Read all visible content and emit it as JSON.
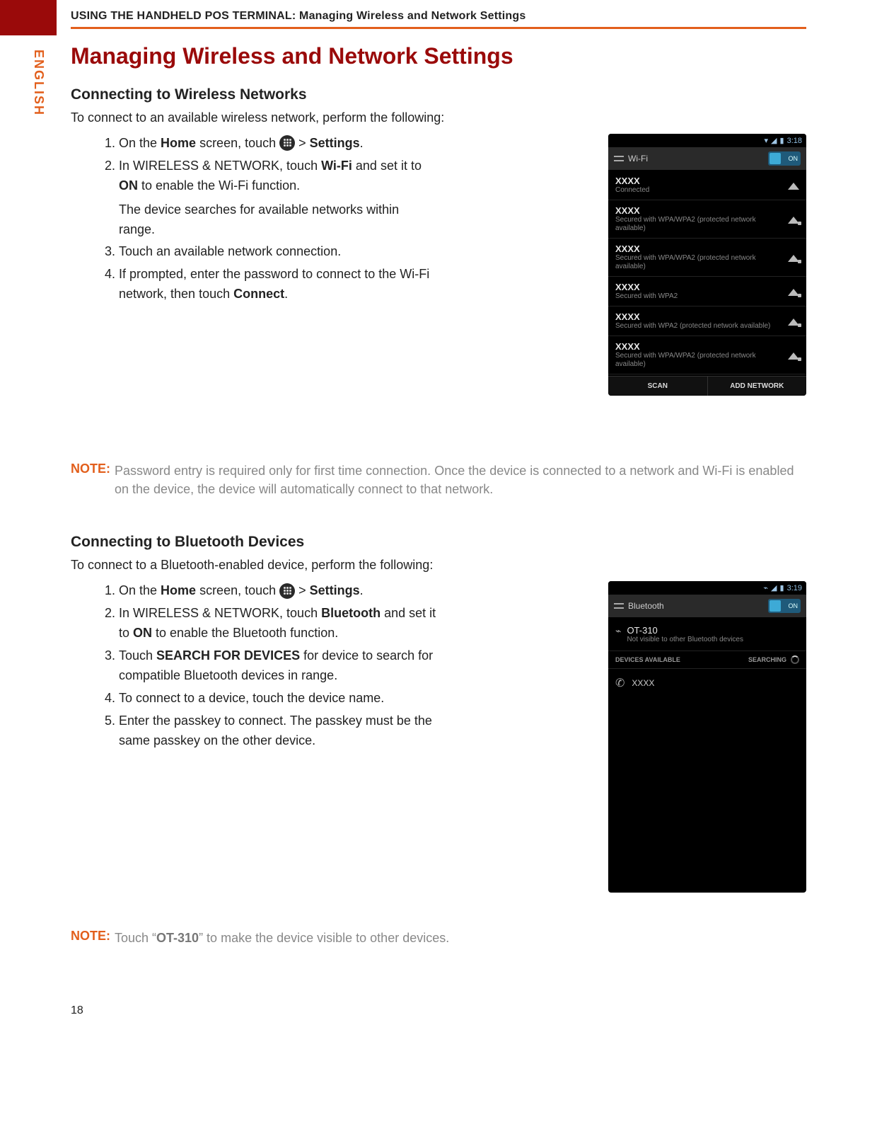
{
  "header": {
    "breadcrumb_prefix": "USING THE HANDHELD POS TERMINAL: ",
    "breadcrumb_section": "Managing Wireless and Network Settings"
  },
  "side_tab": "ENGLISH",
  "title": "Managing Wireless and Network Settings",
  "wifi_section": {
    "heading": "Connecting to Wireless Networks",
    "intro": "To connect to an available wireless network, perform the following:",
    "steps": {
      "s1_pre": "On the ",
      "s1_home": "Home",
      "s1_mid": " screen, touch ",
      "s1_gt": " > ",
      "s1_settings": "Settings",
      "s1_end": ".",
      "s2_a": "In WIRELESS & NETWORK, touch ",
      "s2_wifi": "Wi-Fi",
      "s2_b": " and set it to ",
      "s2_on": "ON",
      "s2_c": " to enable the Wi-Fi function.",
      "s2_extra": "The device searches for available networks within range.",
      "s3": "Touch an available network connection.",
      "s4_a": "If prompted, enter the password to connect to the Wi-Fi network, then touch ",
      "s4_connect": "Connect",
      "s4_b": "."
    },
    "note_label": "NOTE:",
    "note_text": "Password entry is required only for first time connection. Once the device is connected to a network and Wi-Fi is enabled on the device, the device will automatically connect to that network."
  },
  "bt_section": {
    "heading": "Connecting to Bluetooth Devices",
    "intro": "To connect to a Bluetooth-enabled device, perform the following:",
    "steps": {
      "s1_pre": "On the ",
      "s1_home": "Home",
      "s1_mid": " screen, touch ",
      "s1_gt": " > ",
      "s1_settings": "Settings",
      "s1_end": ".",
      "s2_a": "In WIRELESS & NETWORK, touch ",
      "s2_bt": "Bluetooth",
      "s2_b": " and set it to ",
      "s2_on": "ON",
      "s2_c": " to enable the Bluetooth function.",
      "s3_a": "Touch ",
      "s3_search": "SEARCH FOR DEVICES",
      "s3_b": " for device to search for compatible Bluetooth devices in range.",
      "s4": "To connect to a device, touch the device name.",
      "s5": "Enter the passkey to connect. The passkey must be the same passkey on the other device."
    },
    "note_label": "NOTE:",
    "note_a": "Touch “",
    "note_device": "OT-310",
    "note_b": "” to make the device visible to other devices."
  },
  "wifi_phone": {
    "time": "3:18",
    "header": "Wi-Fi",
    "toggle": "ON",
    "networks": [
      {
        "ssid": "XXXX",
        "sub": "Connected",
        "locked": false
      },
      {
        "ssid": "XXXX",
        "sub": "Secured with WPA/WPA2 (protected network available)",
        "locked": true
      },
      {
        "ssid": "XXXX",
        "sub": "Secured with WPA/WPA2 (protected network available)",
        "locked": true
      },
      {
        "ssid": "XXXX",
        "sub": "Secured with WPA2",
        "locked": true
      },
      {
        "ssid": "XXXX",
        "sub": "Secured with WPA2 (protected network available)",
        "locked": true
      },
      {
        "ssid": "XXXX",
        "sub": "Secured with WPA/WPA2 (protected network available)",
        "locked": true
      }
    ],
    "footer": {
      "scan": "SCAN",
      "add": "ADD NETWORK"
    }
  },
  "bt_phone": {
    "time": "3:19",
    "header": "Bluetooth",
    "toggle": "ON",
    "self": {
      "name": "OT-310",
      "sub": "Not visible to other Bluetooth devices"
    },
    "tabs": {
      "left": "DEVICES AVAILABLE",
      "right": "SEARCHING"
    },
    "device": "XXXX"
  },
  "page_number": "18"
}
